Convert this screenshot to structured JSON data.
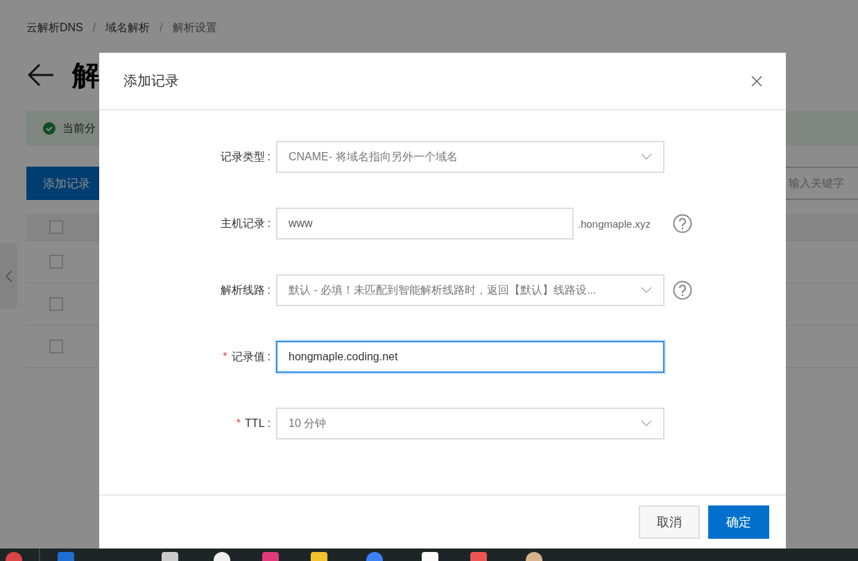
{
  "breadcrumb": [
    {
      "kind": "link",
      "label": "云解析DNS"
    },
    {
      "kind": "separator",
      "label": "/"
    },
    {
      "kind": "link",
      "label": "域名解析"
    },
    {
      "kind": "separator",
      "label": "/"
    },
    {
      "kind": "current",
      "label": "解析设置"
    }
  ],
  "page_title": "解",
  "alert": {
    "text": "当前分"
  },
  "add_button": "添加记录",
  "search": {
    "placeholder": "输入关键字"
  },
  "table_rows": [
    {
      "kind": "header",
      "checked": false
    },
    {
      "kind": "row",
      "checked": false
    },
    {
      "kind": "row",
      "checked": false
    },
    {
      "kind": "row",
      "checked": false
    }
  ],
  "dialog": {
    "title": "添加记录",
    "fields": [
      {
        "kind": "select",
        "label": "记录类型",
        "colon": ":",
        "value": "CNAME- 将域名指向另外一个域名",
        "help": false,
        "focused": false
      },
      {
        "kind": "input",
        "label": "主机记录",
        "colon": ":",
        "value": "www",
        "suffix": ".hongmaple.xyz",
        "help": true,
        "focused": false
      },
      {
        "kind": "select",
        "label": "解析线路",
        "colon": ":",
        "value": "默认 - 必填！未匹配到智能解析线路时，返回【默认】线路设...",
        "help": true,
        "focused": false
      },
      {
        "kind": "input",
        "required_mark": "*",
        "label": "记录值",
        "colon": ":",
        "value": "hongmaple.coding.net",
        "help": false,
        "focused": true
      },
      {
        "kind": "select",
        "required_mark": "*",
        "label": "TTL",
        "colon": ":",
        "value": "10 分钟",
        "help": false,
        "focused": false
      }
    ],
    "buttons": [
      {
        "kind": "secondary",
        "label": "取消"
      },
      {
        "kind": "primary",
        "label": "确定"
      }
    ]
  }
}
